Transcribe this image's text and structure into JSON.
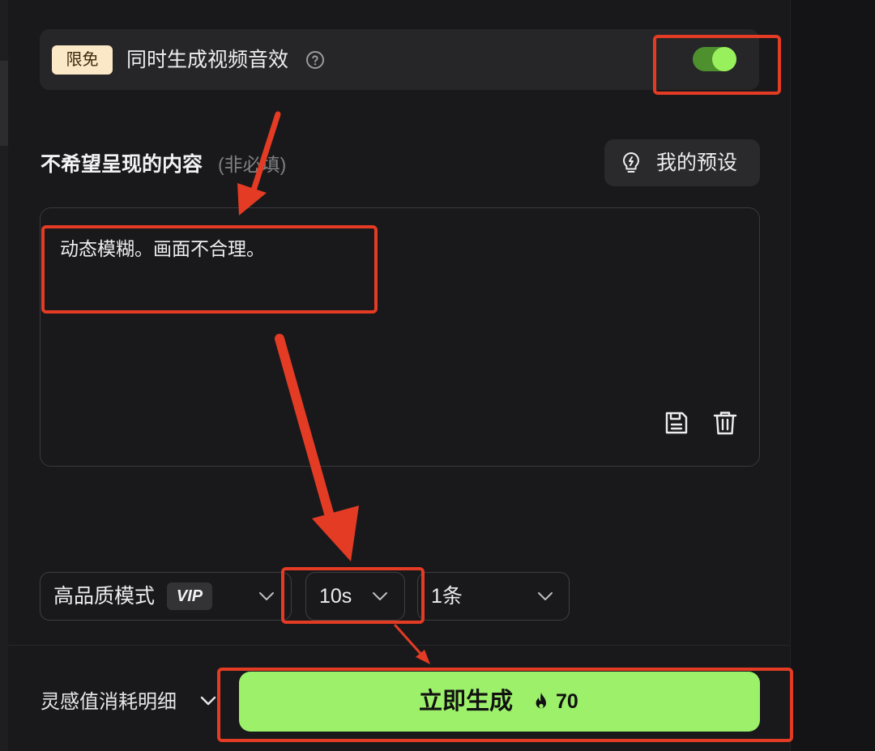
{
  "audio_option": {
    "badge": "限免",
    "label": "同时生成视频音效",
    "help_icon": "question-circle-icon",
    "toggle_on": true
  },
  "negative_prompt": {
    "title": "不希望呈现的内容",
    "optional_hint": "(非必填)",
    "preset_button": "我的预设",
    "preset_icon": "lightbulb-icon",
    "value": "动态模糊。画面不合理。",
    "save_icon": "save-icon",
    "delete_icon": "trash-icon"
  },
  "options": {
    "quality": "高品质模式",
    "quality_badge": "VIP",
    "duration": "10s",
    "count": "1条"
  },
  "footer": {
    "cost_detail": "灵感值消耗明细",
    "generate_label": "立即生成",
    "generate_cost": "70",
    "cost_icon": "flame-icon"
  },
  "colors": {
    "accent_green": "#9df06a",
    "annotation_red": "#e43b24",
    "badge_cream": "#fbe8c6"
  }
}
